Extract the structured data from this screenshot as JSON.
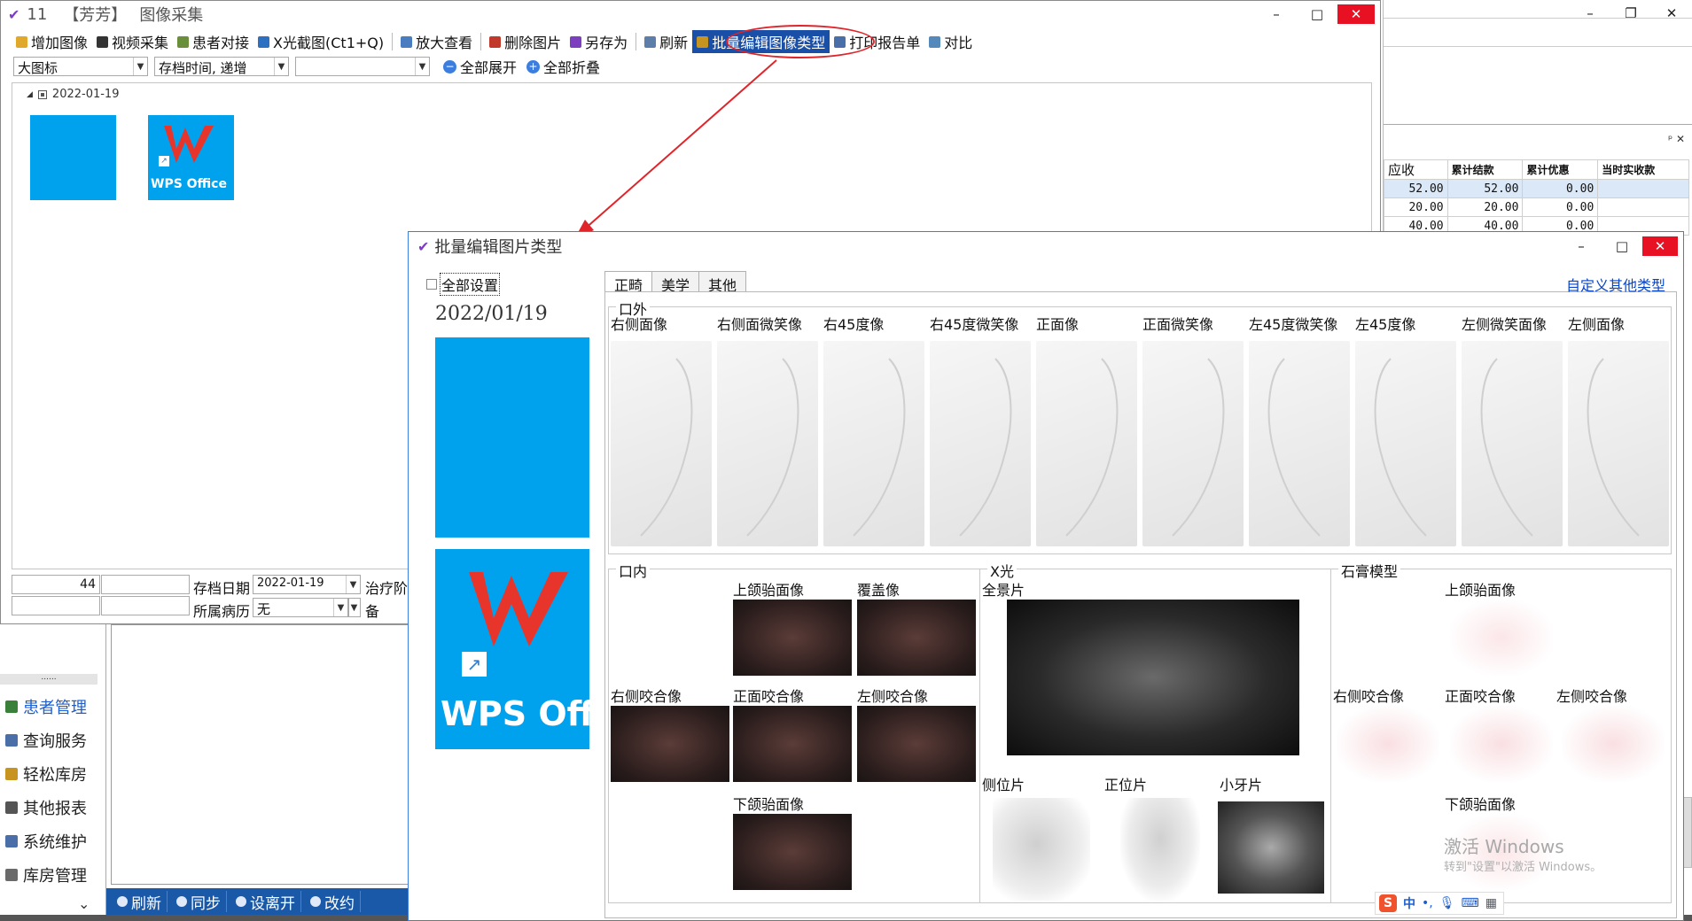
{
  "main_window": {
    "title_num": "11",
    "title_patient": "【芳芳】",
    "title_name": "图像采集",
    "toolbar": [
      {
        "label": "增加图像",
        "icon": "folder-open-icon"
      },
      {
        "label": "视频采集",
        "icon": "video-icon"
      },
      {
        "label": "患者对接",
        "icon": "patient-link-icon"
      },
      {
        "label": "X光截图(Ct1+Q)",
        "icon": "crop-icon"
      },
      {
        "label": "放大查看",
        "icon": "magnify-icon"
      },
      {
        "label": "删除图片",
        "icon": "delete-image-icon"
      },
      {
        "label": "另存为",
        "icon": "save-as-icon"
      },
      {
        "label": "刷新",
        "icon": "refresh-icon"
      },
      {
        "label": "批量编辑图像类型",
        "icon": "batch-edit-icon"
      },
      {
        "label": "打印报告单",
        "icon": "print-report-icon"
      },
      {
        "label": "对比",
        "icon": "compare-icon"
      }
    ],
    "view_select": "大图标",
    "sort_select": "存档时间, 递增",
    "filter_select": "",
    "expand_all": "全部展开",
    "collapse_all": "全部折叠",
    "date_group": "2022-01-19",
    "thumb_wps_label": "WPS Office",
    "bottom": {
      "count": "44",
      "archive_date_label": "存档日期",
      "archive_date": "2022-01-19",
      "treatment_label": "治疗阶",
      "record_label": "所属病历",
      "record_value": "无",
      "note_label": "备"
    }
  },
  "sidebar": {
    "dots": "......",
    "items": [
      {
        "label": "患者管理",
        "icon": "patients-icon",
        "active": true
      },
      {
        "label": "查询服务",
        "icon": "query-icon"
      },
      {
        "label": "轻松库房",
        "icon": "warehouse-icon"
      },
      {
        "label": "其他报表",
        "icon": "report-icon"
      },
      {
        "label": "系统维护",
        "icon": "maintenance-icon"
      },
      {
        "label": "库房管理",
        "icon": "storage-icon"
      }
    ],
    "chevron": "⌄"
  },
  "status_bar": [
    {
      "label": "刷新",
      "icon": "refresh-icon"
    },
    {
      "label": "同步",
      "icon": "sync-icon"
    },
    {
      "label": "设离开",
      "icon": "leave-icon"
    },
    {
      "label": "改约",
      "icon": "reschedule-icon"
    }
  ],
  "right_panel": {
    "headers": [
      "应收",
      "累计结款",
      "累计优惠",
      "当时实收款"
    ],
    "rows": [
      [
        "52.00",
        "52.00",
        "0.00",
        ""
      ],
      [
        "20.00",
        "20.00",
        "0.00",
        ""
      ],
      [
        "40.00",
        "40.00",
        "0.00",
        ""
      ]
    ]
  },
  "dialog": {
    "title": "批量编辑图片类型",
    "set_all": "全部设置",
    "date": "2022/01/19",
    "wps_label": "WPS Offic",
    "tabs": [
      "正畸",
      "美学",
      "其他"
    ],
    "custom_link": "自定义其他类型",
    "extraoral": {
      "title": "口外",
      "labels": [
        "右侧面像",
        "右侧面微笑像",
        "右45度像",
        "右45度微笑像",
        "正面像",
        "正面微笑像",
        "左45度微笑像",
        "左45度像",
        "左侧微笑面像",
        "左侧面像"
      ]
    },
    "intraoral": {
      "title": "口内",
      "upper": "上颌骀面像",
      "overbite": "覆盖像",
      "right": "右侧咬合像",
      "front": "正面咬合像",
      "left": "左侧咬合像",
      "lower": "下颌骀面像"
    },
    "xray": {
      "title": "X光",
      "pano": "全景片",
      "lateral": "侧位片",
      "frontal": "正位片",
      "periapical": "小牙片"
    },
    "model": {
      "title": "石膏模型",
      "upper": "上颌骀面像",
      "right": "右侧咬合像",
      "front": "正面咬合像",
      "left": "左侧咬合像",
      "lower": "下颌骀面像"
    }
  },
  "watermark": {
    "line1": "激活 Windows",
    "line2": "转到\"设置\"以激活 Windows。"
  },
  "ime": {
    "logo": "S",
    "lang": "中"
  }
}
